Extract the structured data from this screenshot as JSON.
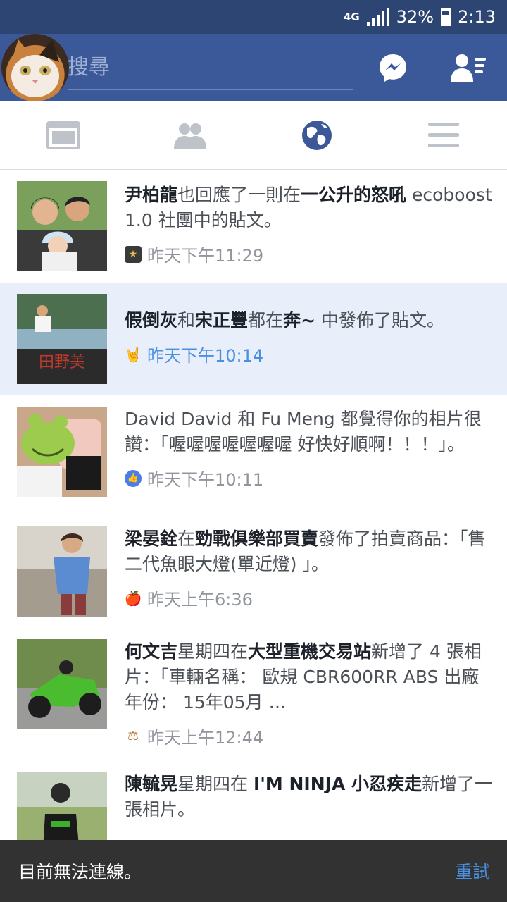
{
  "status_bar": {
    "network": "4G",
    "battery": "32%",
    "time": "2:13"
  },
  "nav": {
    "search_placeholder": "搜尋"
  },
  "tabs": [
    "news-feed",
    "friend-requests",
    "notifications",
    "more"
  ],
  "notifications": [
    {
      "parts": [
        {
          "t": "尹柏龍",
          "b": true
        },
        {
          "t": "也回應了一則在",
          "b": false
        },
        {
          "t": "一公升的怒吼",
          "b": true
        },
        {
          "t": " ecoboost 1.0 社團中的貼文。",
          "b": false
        }
      ],
      "time": "昨天下午11:29",
      "icon": "group-badge-icon",
      "highlight": false
    },
    {
      "parts": [
        {
          "t": "假倒灰",
          "b": true
        },
        {
          "t": "和",
          "b": false
        },
        {
          "t": "宋正豐",
          "b": true
        },
        {
          "t": "都在",
          "b": false
        },
        {
          "t": "奔~",
          "b": true
        },
        {
          "t": " 中發佈了貼文。",
          "b": false
        }
      ],
      "time": "昨天下午10:14",
      "icon": "rock-hand-icon",
      "highlight": true
    },
    {
      "parts": [
        {
          "t": "David David 和 Fu Meng 都覺得你的相片很讚：「喔喔喔喔喔喔喔 好快好順啊！！！」。",
          "b": false
        }
      ],
      "time": "昨天下午10:11",
      "icon": "like-icon",
      "highlight": false
    },
    {
      "parts": [
        {
          "t": "梁晏銓",
          "b": true
        },
        {
          "t": "在",
          "b": false
        },
        {
          "t": "勁戰俱樂部買賣",
          "b": true
        },
        {
          "t": "發佈了拍賣商品：「售 二代魚眼大燈(單近燈) 」。",
          "b": false
        }
      ],
      "time": "昨天上午6:36",
      "icon": "apple-icon",
      "highlight": false
    },
    {
      "parts": [
        {
          "t": "何文吉",
          "b": true
        },
        {
          "t": "星期四在",
          "b": false
        },
        {
          "t": "大型重機交易站",
          "b": true
        },
        {
          "t": "新增了 4 張相片：「車輛名稱： 歐規 CBR600RR ABS 出廠年份： 15年05月 …",
          "b": false
        }
      ],
      "time": "昨天上午12:44",
      "icon": "gavel-icon",
      "highlight": false
    },
    {
      "parts": [
        {
          "t": "陳毓晃",
          "b": true
        },
        {
          "t": "星期四在 ",
          "b": false
        },
        {
          "t": "I'M NINJA 小忍疾走",
          "b": true
        },
        {
          "t": "新增了一張相片。",
          "b": false
        }
      ],
      "time": "",
      "icon": "",
      "highlight": false
    }
  ],
  "snackbar": {
    "message": "目前無法連線。",
    "action": "重試"
  },
  "colors": {
    "brand": "#3b5998",
    "highlight": "#e9effa",
    "link": "#4a90e2"
  }
}
